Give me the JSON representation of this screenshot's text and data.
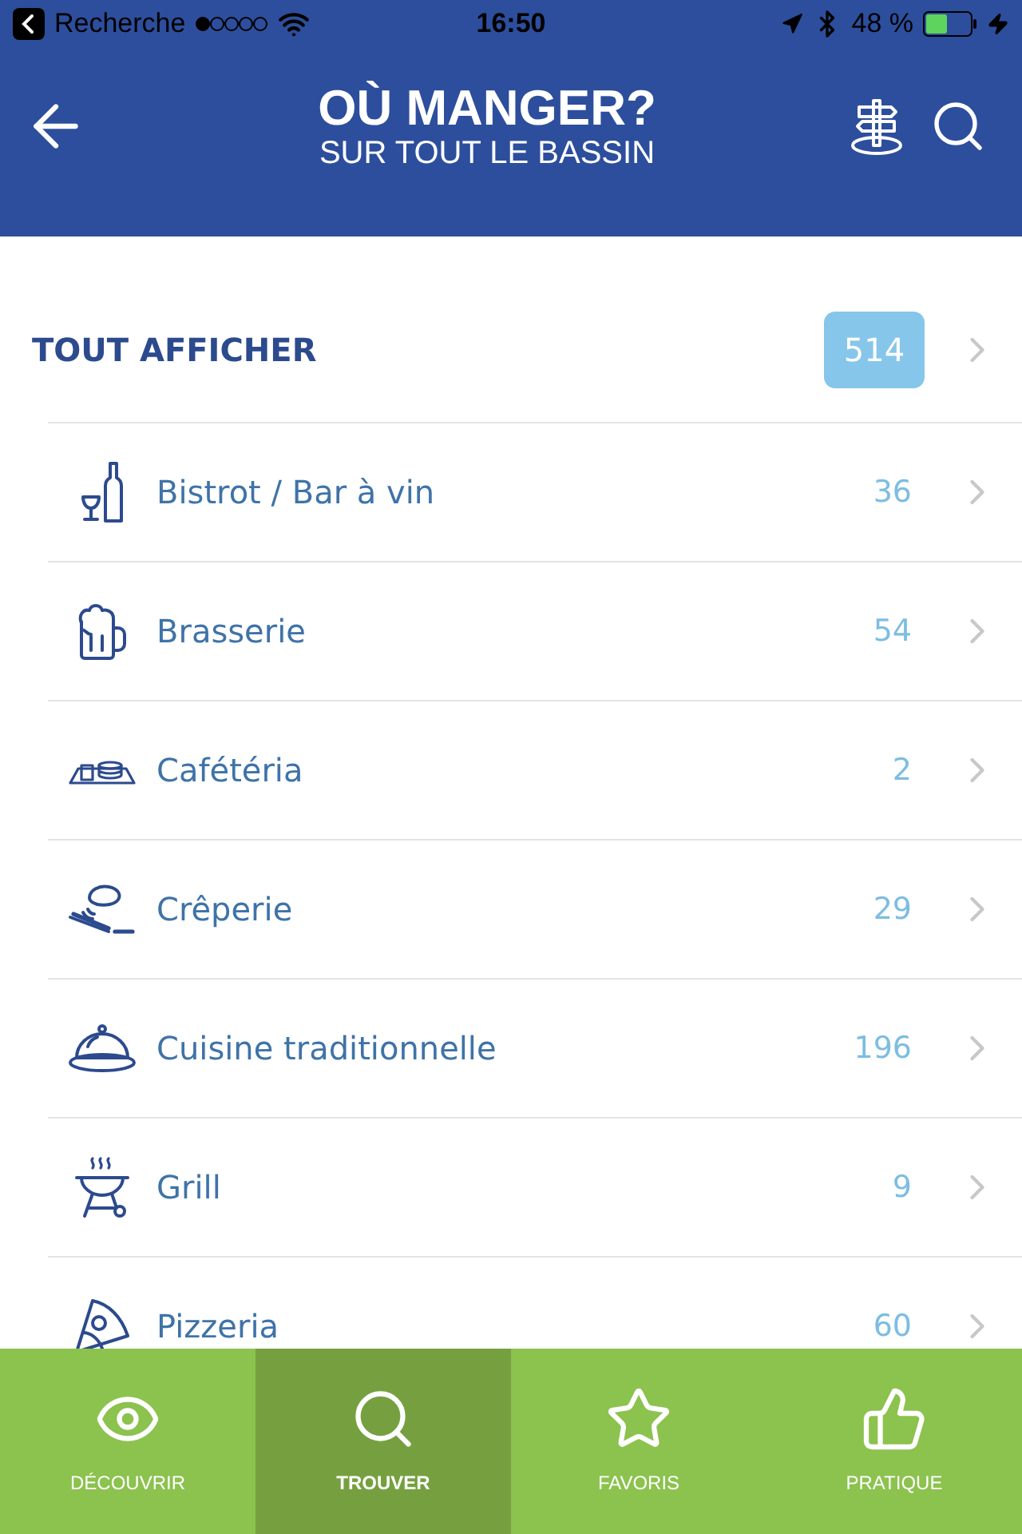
{
  "status_bar": {
    "back_label": "Recherche",
    "time": "16:50",
    "battery": "48 %"
  },
  "header": {
    "title": "OÙ MANGER?",
    "subtitle": "SUR TOUT LE BASSIN"
  },
  "show_all": {
    "label": "TOUT AFFICHER",
    "count": "514"
  },
  "categories": [
    {
      "kind": "wine",
      "label": "Bistrot / Bar à vin",
      "count": "36"
    },
    {
      "kind": "beer",
      "label": "Brasserie",
      "count": "54"
    },
    {
      "kind": "tray",
      "label": "Cafétéria",
      "count": "2"
    },
    {
      "kind": "crepe",
      "label": "Crêperie",
      "count": "29"
    },
    {
      "kind": "cloche",
      "label": "Cuisine traditionnelle",
      "count": "196"
    },
    {
      "kind": "grill",
      "label": "Grill",
      "count": "9"
    },
    {
      "kind": "pizza",
      "label": "Pizzeria",
      "count": "60"
    }
  ],
  "tabs": [
    {
      "kind": "eye",
      "label": "DÉCOUVRIR",
      "selected": false
    },
    {
      "kind": "search",
      "label": "TROUVER",
      "selected": true
    },
    {
      "kind": "star",
      "label": "FAVORIS",
      "selected": false
    },
    {
      "kind": "thumb",
      "label": "PRATIQUE",
      "selected": false
    }
  ]
}
